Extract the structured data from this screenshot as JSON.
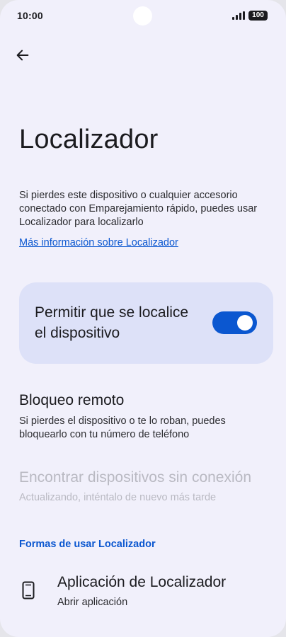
{
  "status_bar": {
    "time": "10:00",
    "battery": "100"
  },
  "header": {
    "back_icon": "arrow-left-icon"
  },
  "page": {
    "title": "Localizador",
    "intro": "Si pierdes este dispositivo o cualquier accesorio conectado con Emparejamiento rápido, puedes usar Localizador para localizarlo",
    "learn_more": "Más información sobre Localizador"
  },
  "allow_locate": {
    "label": "Permitir que se localice el dispositivo",
    "enabled": true
  },
  "remote_lock": {
    "title": "Bloqueo remoto",
    "subtitle": "Si pierdes el dispositivo o te lo roban, puedes bloquearlo con tu número de teléfono"
  },
  "offline_devices": {
    "title": "Encontrar dispositivos sin conexión",
    "subtitle": "Actualizando, inténtalo de nuevo más tarde"
  },
  "ways_section": {
    "header": "Formas de usar Localizador",
    "items": [
      {
        "icon": "phone-icon",
        "title": "Aplicación de Localizador",
        "subtitle": "Abrir aplicación"
      }
    ]
  },
  "colors": {
    "accent": "#0b57d0",
    "background": "#f1f0fb",
    "card": "#dde1f8",
    "disabled_text": "#b9b9c2"
  }
}
